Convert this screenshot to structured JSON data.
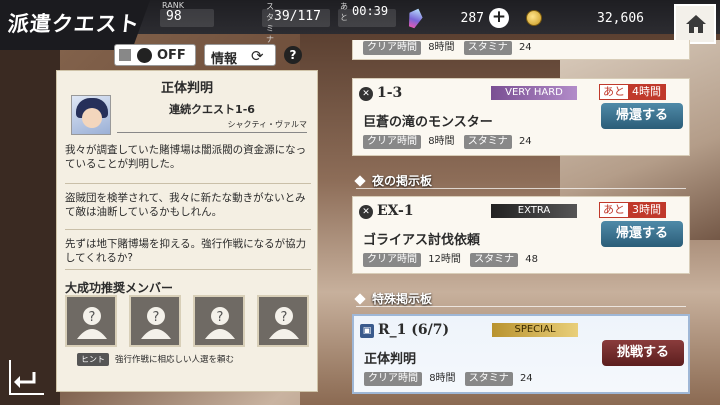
{
  "header": {
    "title": "派遣クエスト",
    "rank_label": "RANK",
    "rank_value": "98",
    "stamina_label": "スタミナ",
    "stamina_value": "39/117",
    "timer_prefix": "あと",
    "timer_value": "00:39",
    "quartz_value": "287",
    "coin_value": "32,606",
    "icons": {
      "quartz": "quartz-icon",
      "coin": "coin-icon",
      "home": "home-icon",
      "plus": "plus-icon"
    }
  },
  "left": {
    "toggle_label": "OFF",
    "info_label": "情報",
    "help_label": "?",
    "quest_title": "正体判明",
    "quest_subtitle": "連続クエスト1-6",
    "npc_name": "シャクティ・ヴァルマ",
    "story": [
      "我々が調査していた賭博場は闇派閥の資金源になっていることが判明した。",
      "盗賊団を検挙されて、我々に新たな動きがないとみて敵は油断しているかもしれん。",
      "先ずは地下賭博場を抑える。強行作戦になるが協力してくれるか?"
    ],
    "member_title": "大成功推奨メンバー",
    "hint_label": "ヒント",
    "hint_text": "強行作戦に相応しい人選を頼む"
  },
  "list": {
    "top_meta": {
      "clear_label": "クリア時間",
      "clear_value": "8時間",
      "stamina_label": "スタミナ",
      "stamina_value": "24"
    },
    "cards": [
      {
        "id": "1-3",
        "difficulty": "VERY HARD",
        "remain_a": "あと",
        "remain_b": "4時間",
        "name": "巨蒼の滝のモンスター",
        "action": "帰還する",
        "clear_label": "クリア時間",
        "clear_value": "8時間",
        "stamina_label": "スタミナ",
        "stamina_value": "24"
      },
      {
        "id": "EX-1",
        "difficulty": "EXTRA",
        "remain_a": "あと",
        "remain_b": "3時間",
        "name": "ゴライアス討伐依頼",
        "action": "帰還する",
        "clear_label": "クリア時間",
        "clear_value": "12時間",
        "stamina_label": "スタミナ",
        "stamina_value": "48"
      },
      {
        "id": "R_1 (6/7)",
        "difficulty": "SPECIAL",
        "name": "正体判明",
        "action": "挑戦する",
        "clear_label": "クリア時間",
        "clear_value": "8時間",
        "stamina_label": "スタミナ",
        "stamina_value": "24"
      }
    ],
    "sections": [
      "夜の掲示板",
      "特殊掲示板"
    ]
  }
}
